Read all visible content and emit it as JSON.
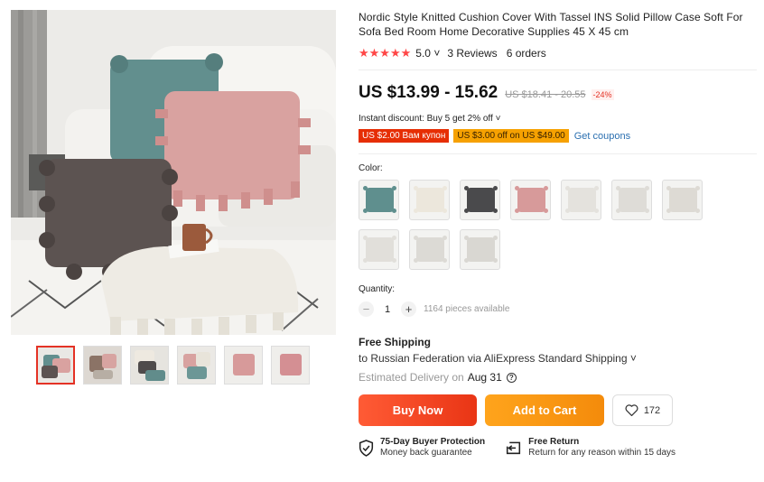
{
  "product": {
    "title": "Nordic Style Knitted Cushion Cover With Tassel INS Solid Pillow Case Soft For Sofa Bed Room Home Decorative Supplies 45 X 45 cm",
    "stars": "★★★★★",
    "rating": "5.0",
    "rating_chevron": "˅",
    "reviews": "3 Reviews",
    "orders": "6 orders"
  },
  "price": {
    "current": "US $13.99 - 15.62",
    "original": "US $18.41 - 20.55",
    "discount": "-24%"
  },
  "promo": {
    "instant_discount": "Instant discount: Buy 5 get 2% off ˅",
    "coupon_red": "US $2.00 Вам купон",
    "coupon_orange": "US $3.00 off on US $49.00",
    "get_coupons": "Get coupons"
  },
  "options": {
    "color_label": "Color:",
    "colors": [
      {
        "name": "teal",
        "color": "#5f8f8e"
      },
      {
        "name": "cream",
        "color": "#ece7dc"
      },
      {
        "name": "charcoal",
        "color": "#4a4a4c"
      },
      {
        "name": "pink",
        "color": "#d79a9a"
      },
      {
        "name": "white-1",
        "color": "#e4e2dd"
      },
      {
        "name": "white-2",
        "color": "#dedcd7"
      },
      {
        "name": "white-3",
        "color": "#dddad4"
      },
      {
        "name": "white-4",
        "color": "#e1dfda"
      },
      {
        "name": "white-5",
        "color": "#dcdad5"
      },
      {
        "name": "white-6",
        "color": "#d9d7d2"
      }
    ]
  },
  "quantity": {
    "label": "Quantity:",
    "minus": "−",
    "value": "1",
    "plus": "+",
    "available": "1164 pieces available"
  },
  "shipping": {
    "title": "Free Shipping",
    "to": "to Russian Federation via AliExpress Standard Shipping ˅",
    "delivery_label": "Estimated Delivery on",
    "delivery_date": "Aug 31",
    "help_icon": "?"
  },
  "actions": {
    "buy_now": "Buy Now",
    "add_to_cart": "Add to Cart",
    "wishlist_count": "172"
  },
  "guarantees": {
    "protection_title": "75-Day Buyer Protection",
    "protection_sub": "Money back guarantee",
    "return_title": "Free Return",
    "return_sub": "Return for any reason within 15 days"
  },
  "colors": {
    "accent_red": "#e43225",
    "star_red": "#ff4747",
    "buy_now": "#f04a22",
    "add_to_cart": "#f89a14",
    "link_blue": "#2a6fb0"
  }
}
